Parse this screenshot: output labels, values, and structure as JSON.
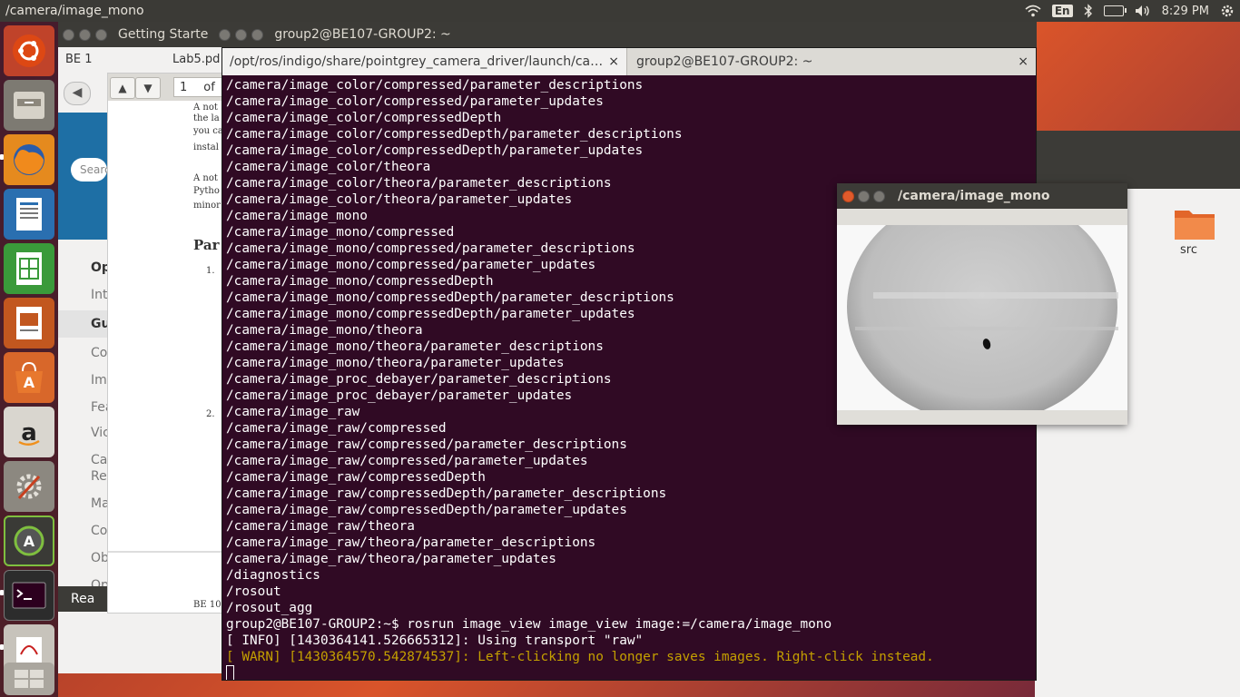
{
  "top_panel": {
    "window_title": "/camera/image_mono",
    "lang": "En",
    "clock": "8:29 PM"
  },
  "launcher": {
    "items": [
      "ubuntu-dash",
      "files",
      "firefox",
      "libreoffice-writer",
      "libreoffice-calc",
      "libreoffice-impress",
      "software-center",
      "amazon",
      "system-settings",
      "software-updater",
      "terminal",
      "pdf-viewer",
      "workspace-switcher"
    ]
  },
  "background": {
    "window_titles": [
      "Getting Starte",
      "group2@BE107-GROUP2: ~"
    ],
    "browser_tab": "BE 1",
    "browser_tab2": "Lab5.pd",
    "search_placeholder": "Searc",
    "menu_items": [
      "Ope",
      "Int",
      "Gu",
      "Co",
      "Im",
      "Fea",
      "Vic",
      "Ca",
      "Re",
      "Ma",
      "Co",
      "Ob",
      "Op"
    ],
    "pdf_page": "1",
    "pdf_of": "of",
    "pdf_lines": [
      "A not",
      "the la",
      "you ca",
      "instal",
      "A not",
      "Pytho",
      "minor",
      "Par",
      "1.",
      "2.",
      "BE 10"
    ],
    "reader_label": "Rea",
    "folder_label": "src"
  },
  "terminal": {
    "tabs": [
      {
        "label": "/opt/ros/indigo/share/pointgrey_camera_driver/launch/ca…",
        "active": true
      },
      {
        "label": "group2@BE107-GROUP2: ~",
        "active": false
      }
    ],
    "close_glyph": "×",
    "lines": [
      "/camera/image_color/compressed/parameter_descriptions",
      "/camera/image_color/compressed/parameter_updates",
      "/camera/image_color/compressedDepth",
      "/camera/image_color/compressedDepth/parameter_descriptions",
      "/camera/image_color/compressedDepth/parameter_updates",
      "/camera/image_color/theora",
      "/camera/image_color/theora/parameter_descriptions",
      "/camera/image_color/theora/parameter_updates",
      "/camera/image_mono",
      "/camera/image_mono/compressed",
      "/camera/image_mono/compressed/parameter_descriptions",
      "/camera/image_mono/compressed/parameter_updates",
      "/camera/image_mono/compressedDepth",
      "/camera/image_mono/compressedDepth/parameter_descriptions",
      "/camera/image_mono/compressedDepth/parameter_updates",
      "/camera/image_mono/theora",
      "/camera/image_mono/theora/parameter_descriptions",
      "/camera/image_mono/theora/parameter_updates",
      "/camera/image_proc_debayer/parameter_descriptions",
      "/camera/image_proc_debayer/parameter_updates",
      "/camera/image_raw",
      "/camera/image_raw/compressed",
      "/camera/image_raw/compressed/parameter_descriptions",
      "/camera/image_raw/compressed/parameter_updates",
      "/camera/image_raw/compressedDepth",
      "/camera/image_raw/compressedDepth/parameter_descriptions",
      "/camera/image_raw/compressedDepth/parameter_updates",
      "/camera/image_raw/theora",
      "/camera/image_raw/theora/parameter_descriptions",
      "/camera/image_raw/theora/parameter_updates",
      "/diagnostics",
      "/rosout",
      "/rosout_agg",
      "group2@BE107-GROUP2:~$ rosrun image_view image_view image:=/camera/image_mono",
      "[ INFO] [1430364141.526665312]: Using transport \"raw\""
    ],
    "warn_line": "[ WARN] [1430364570.542874537]: Left-clicking no longer saves images. Right-click instead."
  },
  "image_window": {
    "title": "/camera/image_mono"
  },
  "colors": {
    "terminal_bg": "#300a24",
    "warn": "#c4a000",
    "close_button": "#e05a2b"
  }
}
